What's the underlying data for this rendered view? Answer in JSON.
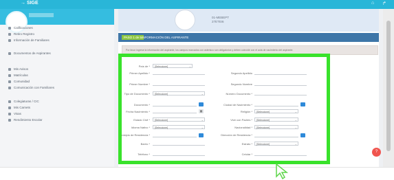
{
  "app": {
    "logo_text": "→ SIGE",
    "top_right_1": "⌂",
    "top_right_2": "↱"
  },
  "sidebar": {
    "items": [
      {
        "label": "Calificaciones",
        "icon": "book-icon"
      },
      {
        "label": "Retiro Registro",
        "icon": "list-icon"
      },
      {
        "label": "Información de Familiares",
        "icon": "users-icon"
      },
      {
        "label": "Documentos de Aspirantes",
        "icon": "file-icon"
      },
      {
        "label": "Mis Avisos",
        "icon": "bell-icon"
      },
      {
        "label": "Matrículas",
        "icon": "clipboard-icon"
      },
      {
        "label": "Comunidad",
        "icon": "group-icon"
      },
      {
        "label": "Comunicación con Familiares",
        "icon": "chat-icon"
      },
      {
        "label": "Colegiaturas / CIC",
        "icon": "money-icon"
      },
      {
        "label": "Mis Carnets",
        "icon": "id-icon"
      },
      {
        "label": "Visas",
        "icon": "passport-icon"
      },
      {
        "label": "Rendimiento Escolar",
        "icon": "chart-icon"
      }
    ]
  },
  "profile": {
    "line1": "01-MEBEPT",
    "line2": "27ETEI6"
  },
  "section": {
    "badge": "PASO 1 de 5",
    "title": "INFORMACIÓN DEL ASPIRANTE",
    "notice": "Por favor ingrese la información del aspirante, los campos marcados con asterisco son obligatorios y deben coincidir con el acta de nacimiento del aspirante."
  },
  "form": {
    "select_placeholder": "[Seleccione]",
    "calendar_icon": "▦",
    "left": [
      {
        "label": "País de *",
        "type": "select"
      },
      {
        "label": "Primer Apellido *",
        "type": "text"
      },
      {
        "label": "Primer Nombre *",
        "type": "text"
      },
      {
        "label": "Tipo de Documento *",
        "type": "select"
      },
      {
        "label": "Documento *",
        "type": "text-button"
      },
      {
        "label": "Fecha Nacimiento *",
        "type": "date"
      },
      {
        "label": "Estado Civil *",
        "type": "select"
      },
      {
        "label": "Idioma Nativo *",
        "type": "select"
      },
      {
        "label": "Municipio de Residencia *",
        "type": "text-button"
      },
      {
        "label": "Barrio *",
        "type": "text"
      },
      {
        "label": "Teléfono *",
        "type": "text"
      }
    ],
    "right": [
      {
        "label": "Segundo Apellido",
        "type": "text"
      },
      {
        "label": "Segundo Nombre",
        "type": "text"
      },
      {
        "label": "Número Documento *",
        "type": "text"
      },
      {
        "label": "Ciudad de Nacimiento *",
        "type": "text-button"
      },
      {
        "label": "Religión *",
        "type": "select"
      },
      {
        "label": "Vive con Padres *",
        "type": "select"
      },
      {
        "label": "Nacionalidad *",
        "type": "select"
      },
      {
        "label": "Dirección de Residencia *",
        "type": "text-button"
      },
      {
        "label": "Estrato *",
        "type": "select"
      },
      {
        "label": "Celular *",
        "type": "text"
      }
    ]
  },
  "fab_label": "?",
  "colors": {
    "topbar": "#29b6d8",
    "section_header": "#3e76a8",
    "badge": "#8dc63f",
    "highlight": "#39e22b",
    "fab": "#f0554f",
    "button": "#2f8ad9"
  }
}
